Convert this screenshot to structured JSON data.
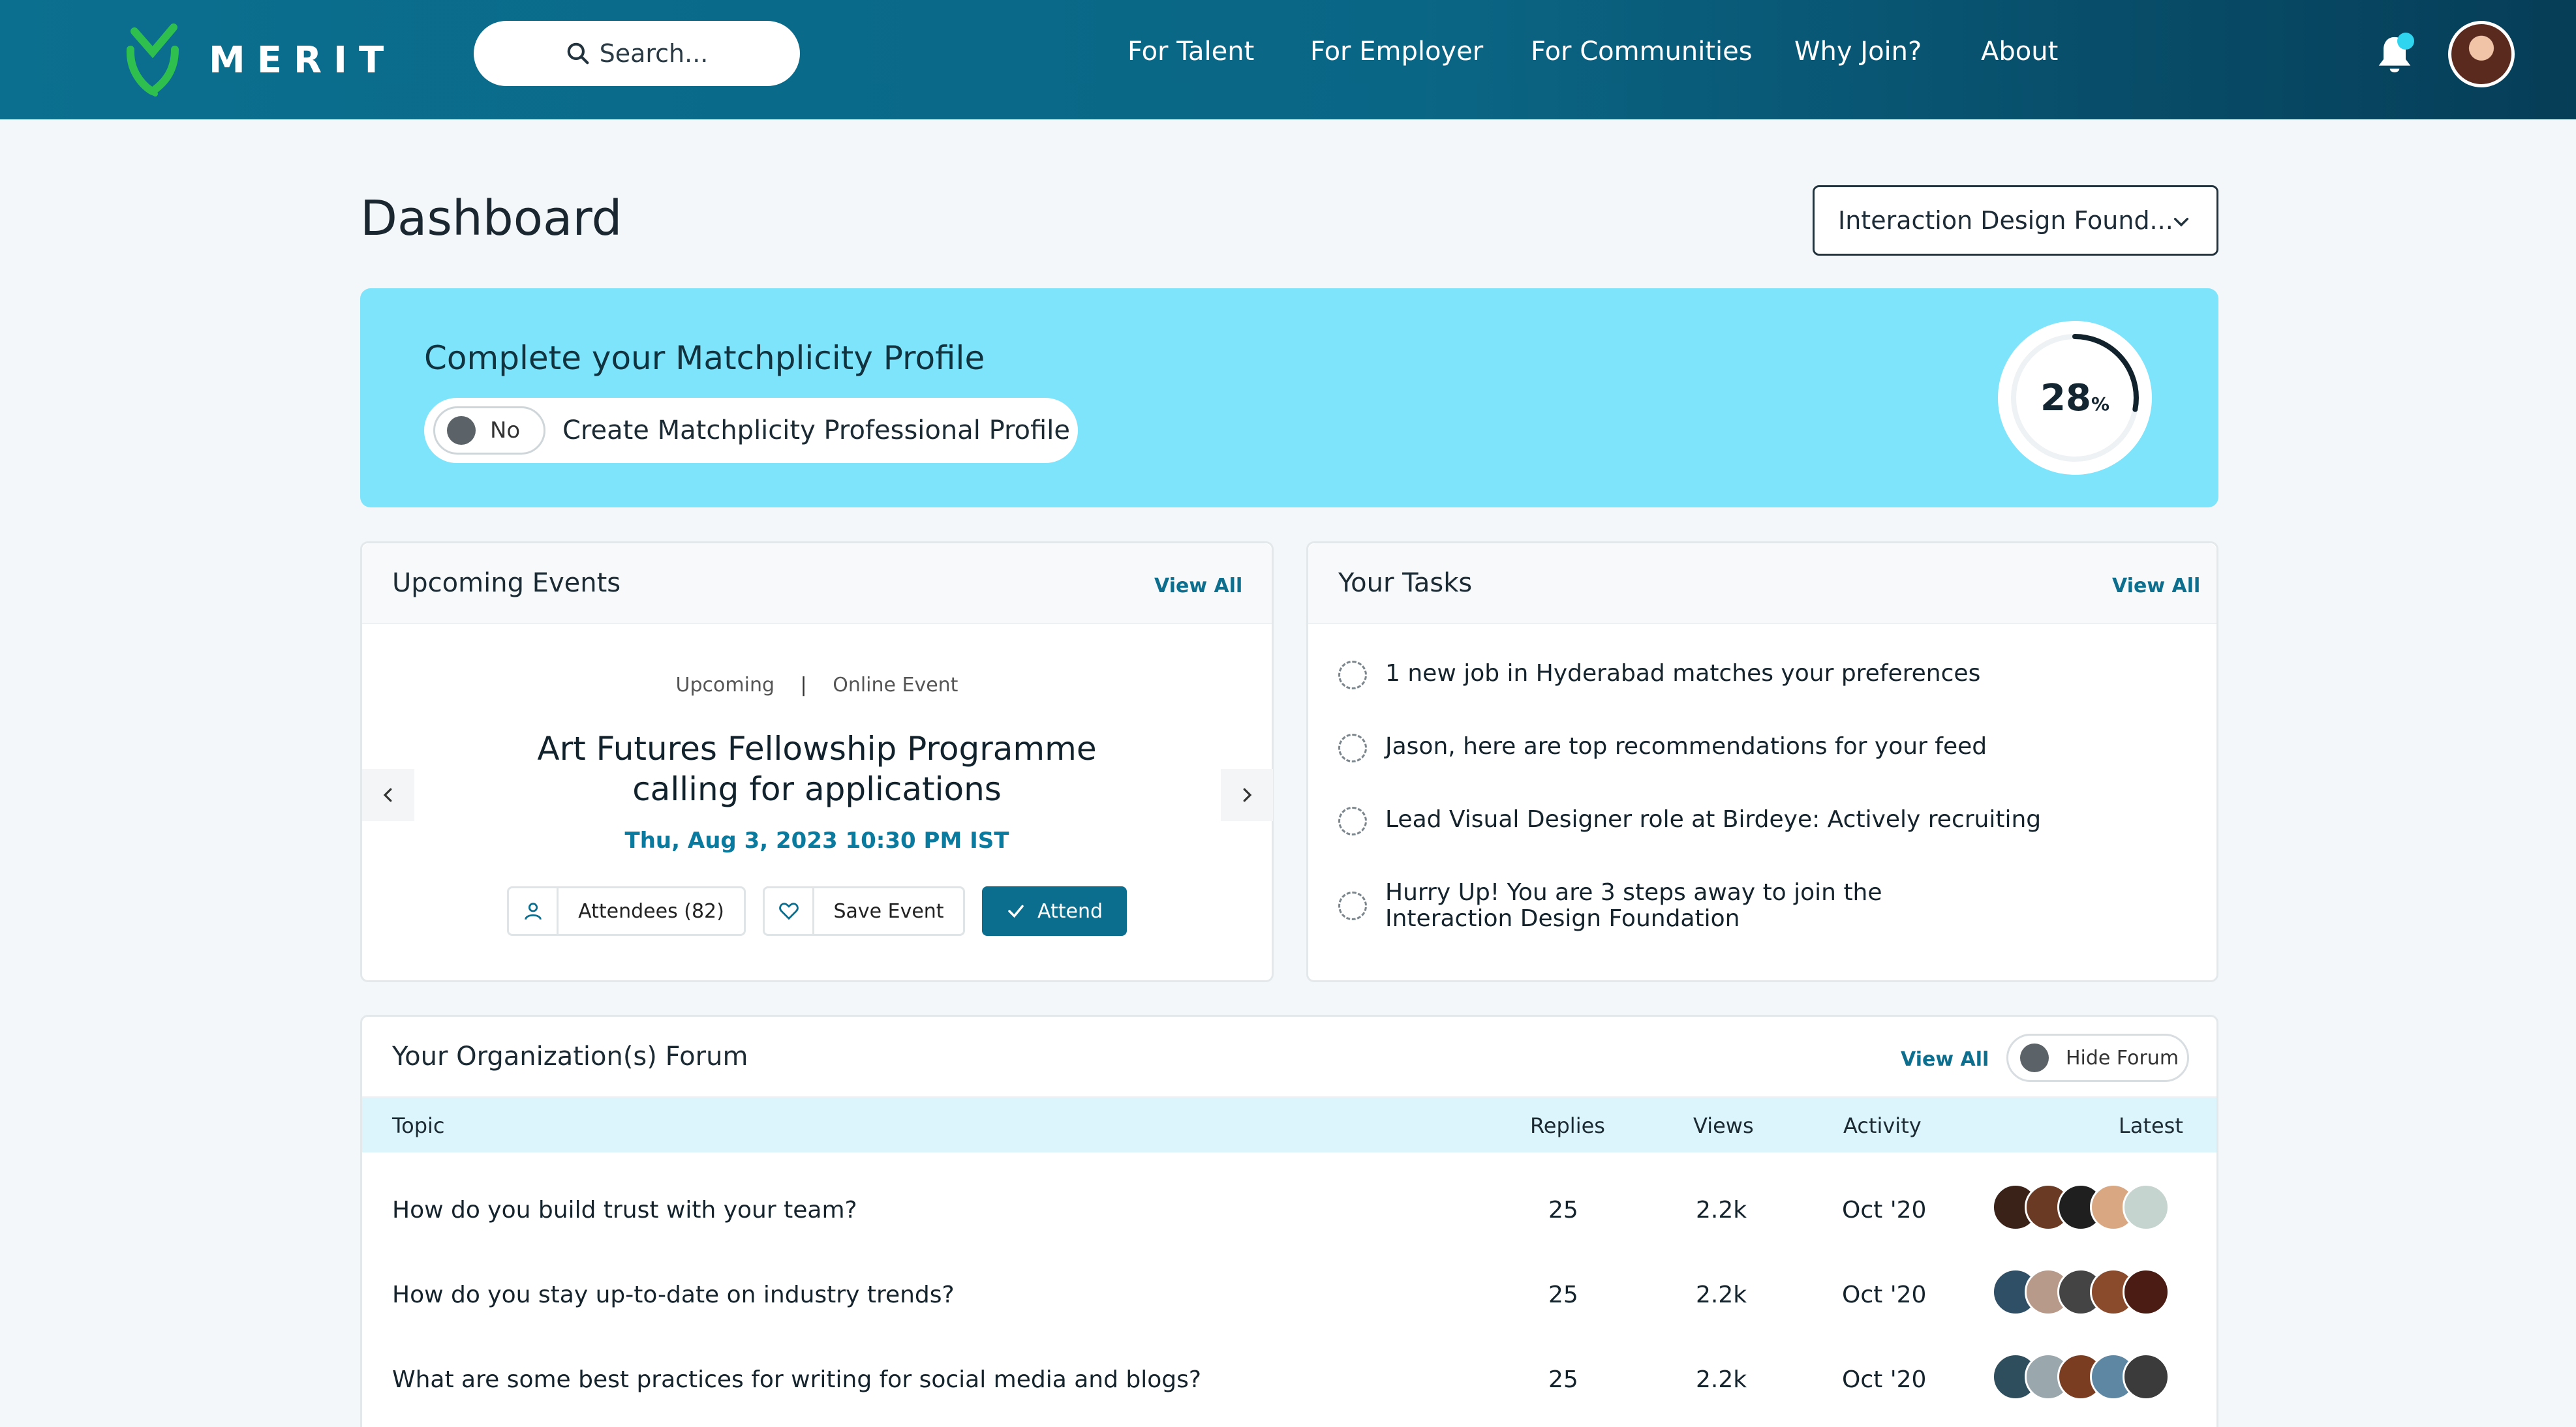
{
  "nav": {
    "brand": "MERIT",
    "search_placeholder": "Search...",
    "links": [
      "For Talent",
      "For Employer",
      "For Communities",
      "Why Join?",
      "About"
    ],
    "accent_color": "#0b6f8f"
  },
  "page": {
    "title": "Dashboard",
    "org_selector": "Interaction Design Found..."
  },
  "profile_banner": {
    "title": "Complete your Matchplicity Profile",
    "toggle_state": "No",
    "toggle_label": "Create Matchplicity Professional Profile",
    "progress_value": "28",
    "progress_unit": "%",
    "progress_fraction": 0.28,
    "background_color": "#7ee4fb"
  },
  "events": {
    "title": "Upcoming Events",
    "view_all": "View All",
    "status": "Upcoming",
    "type": "Online Event",
    "event_title_line1": "Art Futures Fellowship Programme",
    "event_title_line2": "calling for applications",
    "date": "Thu, Aug 3, 2023 10:30 PM IST",
    "attendees_label": "Attendees (82)",
    "save_label": "Save Event",
    "attend_label": "Attend"
  },
  "tasks": {
    "title": "Your Tasks",
    "view_all": "View All",
    "items": [
      {
        "line1": "1 new job in Hyderabad matches your preferences",
        "line2": ""
      },
      {
        "line1": "Jason, here are top recommendations for your feed",
        "line2": ""
      },
      {
        "line1": "Lead Visual Designer role at Birdeye: Actively recruiting",
        "line2": ""
      },
      {
        "line1": "Hurry Up! You are 3 steps away to join the",
        "line2": "Interaction Design Foundation"
      }
    ]
  },
  "forum": {
    "title": "Your Organization(s) Forum",
    "view_all": "View All",
    "hide_label": "Hide Forum",
    "columns": {
      "topic": "Topic",
      "replies": "Replies",
      "views": "Views",
      "activity": "Activity",
      "latest": "Latest"
    },
    "rows": [
      {
        "topic": "How do you build trust with your team?",
        "replies": "25",
        "views": "2.2k",
        "activity": "Oct '20"
      },
      {
        "topic": "How do you stay up-to-date on industry trends?",
        "replies": "25",
        "views": "2.2k",
        "activity": "Oct '20"
      },
      {
        "topic": "What are some best practices for writing for social media and blogs?",
        "replies": "25",
        "views": "2.2k",
        "activity": "Oct '20"
      }
    ]
  }
}
